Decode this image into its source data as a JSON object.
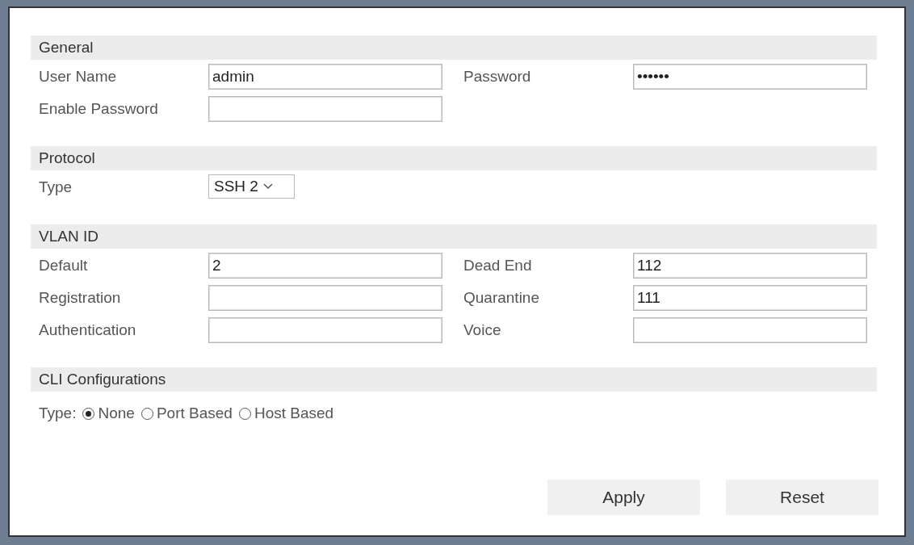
{
  "sections": [
    {
      "title": "General",
      "kind": "fields",
      "rows": [
        [
          {
            "label": "User Name",
            "kind": "text",
            "value": "admin"
          },
          {
            "label": "Password",
            "kind": "password",
            "value": "••••••"
          }
        ],
        [
          {
            "label": "Enable Password",
            "kind": "password"
          }
        ]
      ]
    },
    {
      "title": "Protocol",
      "kind": "fields",
      "rows": [
        [
          {
            "label": "Type",
            "kind": "select",
            "value": "SSH 2"
          }
        ]
      ]
    },
    {
      "title": "VLAN ID",
      "kind": "fields",
      "rows": [
        [
          {
            "label": "Default",
            "kind": "text",
            "value": "2"
          },
          {
            "label": "Dead End",
            "kind": "text",
            "value": "112"
          }
        ],
        [
          {
            "label": "Registration",
            "kind": "text"
          },
          {
            "label": "Quarantine",
            "kind": "text",
            "value": "111"
          }
        ],
        [
          {
            "label": "Authentication",
            "kind": "text"
          },
          {
            "label": "Voice",
            "kind": "text"
          }
        ]
      ]
    },
    {
      "title": "CLI Configurations",
      "kind": "radios",
      "label": "Type:",
      "options": [
        {
          "label": "None",
          "selected": true
        },
        {
          "label": "Port Based",
          "selected": false
        },
        {
          "label": "Host Based",
          "selected": false
        }
      ]
    }
  ],
  "buttons": [
    "Apply",
    "Reset"
  ]
}
